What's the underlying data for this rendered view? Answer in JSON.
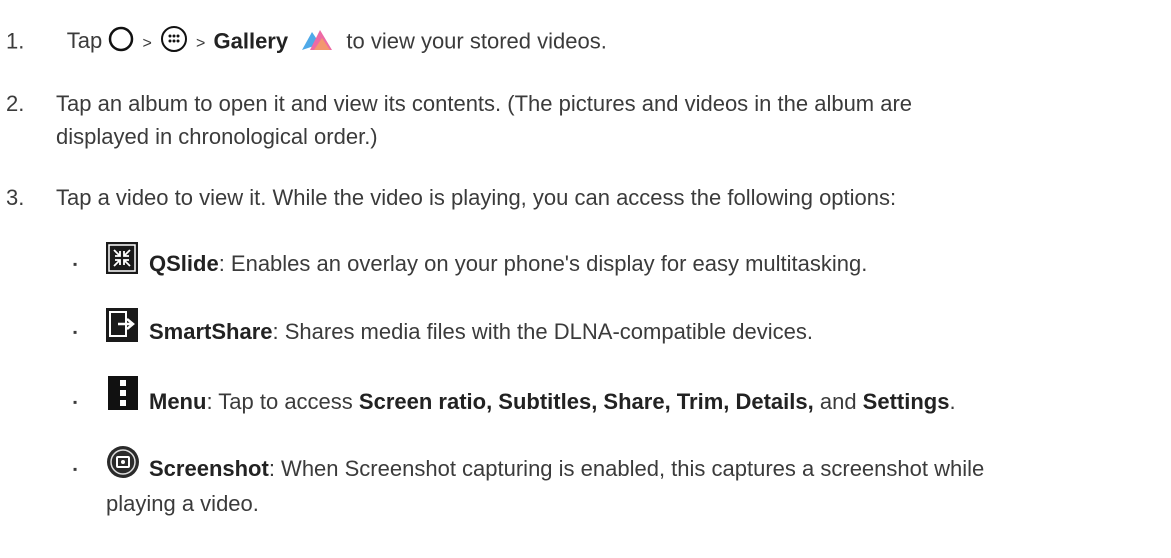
{
  "step1": {
    "num": "1.",
    "tap": "Tap",
    "sep1": ">",
    "sep2": ">",
    "gallery": "Gallery",
    "rest": "to view your stored videos."
  },
  "step2": {
    "num": "2.",
    "line1": "Tap an album to open it and view its contents. (The pictures and videos in the album are",
    "line2": "displayed in chronological order.)"
  },
  "step3": {
    "num": "3.",
    "text": "Tap a video to view it. While the video is playing, you can access the following options:"
  },
  "options": {
    "bullet": "▪",
    "qslide": {
      "label": "QSlide",
      "desc": ": Enables an overlay on your phone's display for easy multitasking."
    },
    "smartshare": {
      "label": "SmartShare",
      "desc": ": Shares media files with the DLNA-compatible devices."
    },
    "menu": {
      "label": "Menu",
      "desc": ": Tap to access ",
      "items": "Screen ratio, Subtitles, Share, Trim, Details,",
      "and": " and ",
      "settings": "Settings",
      "end": "."
    },
    "screenshot": {
      "label": "Screenshot",
      "desc": ": When Screenshot capturing is enabled, this captures a screenshot while",
      "desc2": "playing a video."
    }
  }
}
